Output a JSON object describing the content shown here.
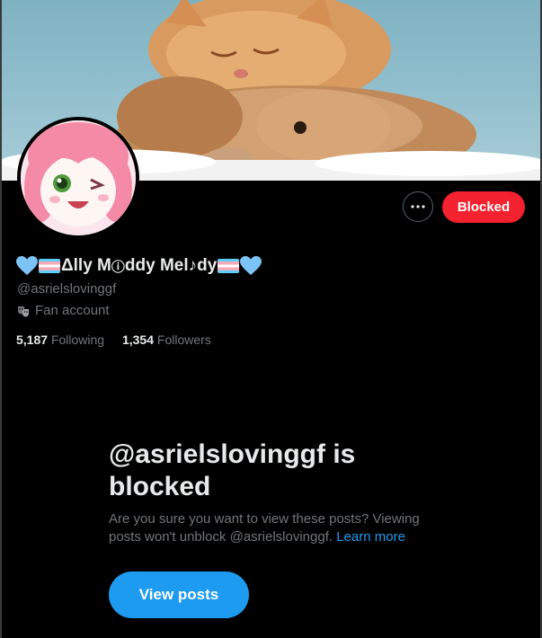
{
  "profile": {
    "name_part1": "Δlly M",
    "name_box": "ⓘ",
    "name_part2": "ddy Mel",
    "name_note": "♪",
    "name_part3": "dy",
    "handle": "@asrielslovinggf",
    "category": "Fan account",
    "category_icon": "theater-masks-icon",
    "following_count": "5,187",
    "following_label": "Following",
    "followers_count": "1,354",
    "followers_label": "Followers"
  },
  "actions": {
    "more_icon": "more-horizontal-icon",
    "blocked_label": "Blocked"
  },
  "blocked_notice": {
    "title": "@asrielslovinggf is blocked",
    "desc": "Are you sure you want to view these posts? Viewing posts won't unblock @asrielslovinggf.",
    "learn_more": "Learn more",
    "view_posts": "View posts"
  },
  "colors": {
    "background": "#000000",
    "blocked_red": "#f4212e",
    "accent_blue": "#1d9bf0",
    "muted_text": "#71767b",
    "primary_text": "#e7e9ea",
    "heart_blue": "#7cc4f7"
  }
}
